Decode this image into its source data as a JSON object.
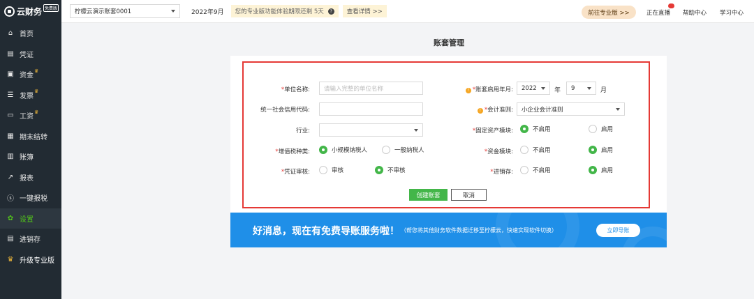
{
  "app": {
    "logo_text": "云财务",
    "logo_badge": "免费版"
  },
  "sidebar": {
    "items": [
      {
        "label": "首页",
        "icon": "home-icon"
      },
      {
        "label": "凭证",
        "icon": "voucher-icon"
      },
      {
        "label": "资金",
        "icon": "fund-icon",
        "premium": true
      },
      {
        "label": "发票",
        "icon": "invoice-icon",
        "premium": true
      },
      {
        "label": "工资",
        "icon": "salary-icon",
        "premium": true
      },
      {
        "label": "期末结转",
        "icon": "closing-icon"
      },
      {
        "label": "账簿",
        "icon": "ledger-icon"
      },
      {
        "label": "报表",
        "icon": "report-icon"
      },
      {
        "label": "一键报税",
        "icon": "tax-icon"
      },
      {
        "label": "设置",
        "icon": "gear-icon",
        "active": true
      },
      {
        "label": "进销存",
        "icon": "inventory-icon"
      },
      {
        "label": "升级专业版",
        "icon": "crown-icon"
      }
    ],
    "crown_glyph": "♛"
  },
  "topbar": {
    "account": "柠檬云演示账套0001",
    "period": "2022年9月",
    "trial_text": "您的专业版功能体验期限还剩 5天",
    "trial_q": "?",
    "detail_link": "查看详情 >>",
    "go_pro": "前往专业版 >>",
    "links": [
      "正在直播",
      "帮助中心",
      "学习中心"
    ]
  },
  "page": {
    "title": "账套管理"
  },
  "form": {
    "unit_name_label": "单位名称:",
    "unit_name_placeholder": "请输入完整的单位名称",
    "credit_code_label": "统一社会信用代码:",
    "industry_label": "行业:",
    "vat_label": "增值税种类:",
    "vat_options": [
      "小规模纳税人",
      "一般纳税人"
    ],
    "voucher_label": "凭证审核:",
    "voucher_options": [
      "审核",
      "不审核"
    ],
    "start_label": "账套启用年月:",
    "start_year": "2022",
    "year_unit": "年",
    "start_month": "9",
    "month_unit": "月",
    "standard_label": "会计准则:",
    "standard_value": "小企业会计准则",
    "fixed_asset_label": "固定资产模块:",
    "fund_label": "资金模块:",
    "inventory_label": "进销存:",
    "toggle_options": [
      "不启用",
      "启用"
    ],
    "create_button": "创建账套",
    "cancel_button": "取消",
    "asterisk": "*",
    "warn_glyph": "!"
  },
  "banner": {
    "headline": "好消息，现在有免费导账服务啦！",
    "sub": "（帮您将其他财务软件数据迁移至柠檬云，快速实现软件切换）",
    "cta": "立即导账"
  },
  "colors": {
    "accent": "#43b649",
    "danger": "#e53935",
    "banner": "#1f8fe8",
    "sidebar": "#222b33"
  }
}
